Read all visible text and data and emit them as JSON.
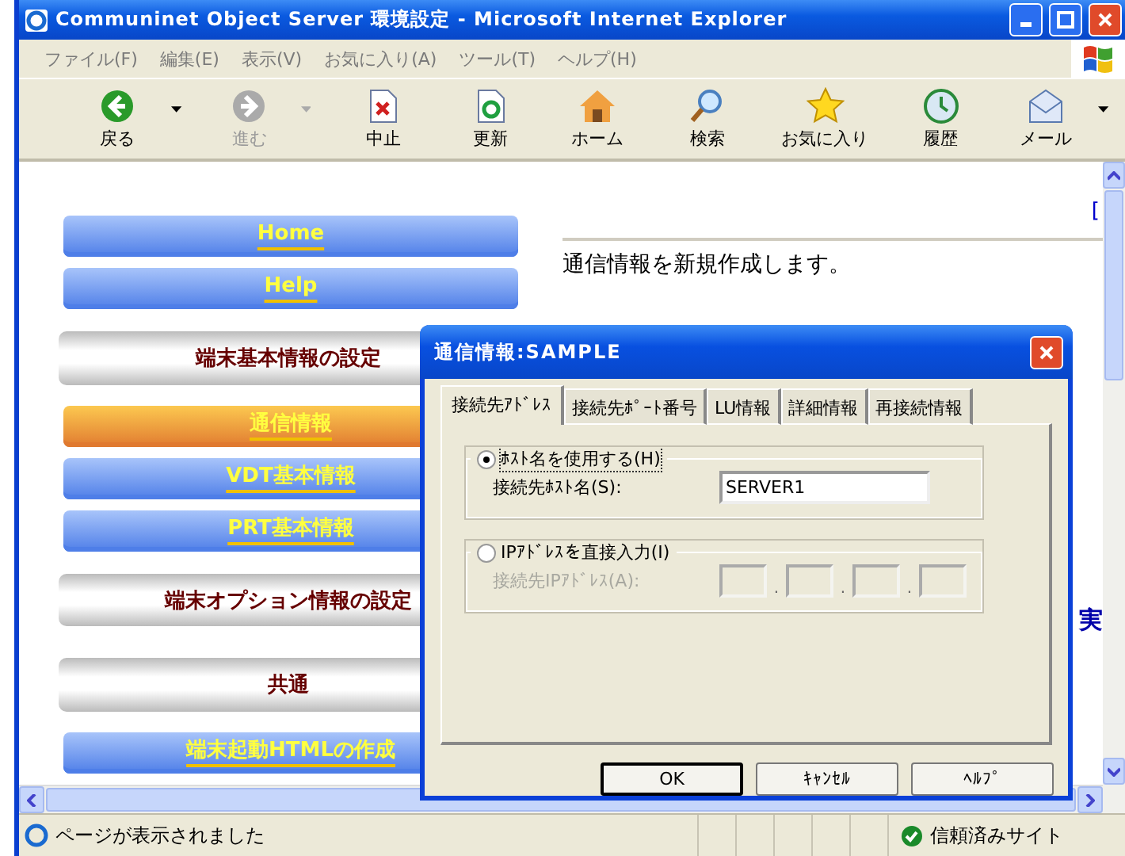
{
  "window": {
    "title": "Communinet Object Server 環境設定 - Microsoft Internet Explorer"
  },
  "menu": [
    "ファイル(F)",
    "編集(E)",
    "表示(V)",
    "お気に入り(A)",
    "ツール(T)",
    "ヘルプ(H)"
  ],
  "toolbar": [
    {
      "label": "戻る",
      "kind": "back",
      "disabled": false,
      "dropdown": true
    },
    {
      "label": "進む",
      "kind": "forward",
      "disabled": true,
      "dropdown": true
    },
    {
      "label": "中止",
      "kind": "stop",
      "disabled": false,
      "dropdown": false
    },
    {
      "label": "更新",
      "kind": "refresh",
      "disabled": false,
      "dropdown": false
    },
    {
      "label": "ホーム",
      "kind": "home",
      "disabled": false,
      "dropdown": false
    },
    {
      "label": "検索",
      "kind": "search",
      "disabled": false,
      "dropdown": false
    },
    {
      "label": "お気に入り",
      "kind": "favorites",
      "disabled": false,
      "dropdown": false
    },
    {
      "label": "履歴",
      "kind": "history",
      "disabled": false,
      "dropdown": false
    },
    {
      "label": "メール",
      "kind": "mail",
      "disabled": false,
      "dropdown": true
    }
  ],
  "nav": [
    {
      "label": "Home",
      "kind": "link",
      "selected": false
    },
    {
      "label": "Help",
      "kind": "link",
      "selected": false
    },
    {
      "label": "端末基本情報の設定",
      "kind": "section"
    },
    {
      "label": "通信情報",
      "kind": "link",
      "selected": true
    },
    {
      "label": "VDT基本情報",
      "kind": "link",
      "selected": false
    },
    {
      "label": "PRT基本情報",
      "kind": "link",
      "selected": false
    },
    {
      "label": "端末オプション情報の設定",
      "kind": "section"
    },
    {
      "label": "共通",
      "kind": "section"
    },
    {
      "label": "端末起動HTMLの作成",
      "kind": "link",
      "selected": false
    }
  ],
  "page": {
    "link": "[",
    "message": "通信情報を新規作成します。",
    "side_text": "実"
  },
  "dialog": {
    "title": "通信情報:SAMPLE",
    "tabs": [
      {
        "label": "接続先ｱﾄﾞﾚｽ",
        "selected": true
      },
      {
        "label": "接続先ﾎﾟｰﾄ番号",
        "selected": false
      },
      {
        "label": "LU情報",
        "selected": false
      },
      {
        "label": "詳細情報",
        "selected": false
      },
      {
        "label": "再接続情報",
        "selected": false
      }
    ],
    "groups": [
      {
        "label": "ﾎｽﾄ名を使用する(H)",
        "selected": true,
        "disabled": false,
        "field_label": "接続先ﾎｽﾄ名(S):",
        "kind": "text",
        "value": "SERVER1"
      },
      {
        "label": "IPｱﾄﾞﾚｽを直接入力(I)",
        "selected": false,
        "disabled": true,
        "field_label": "接続先IPｱﾄﾞﾚｽ(A):",
        "kind": "ip",
        "separators": [
          ".",
          ".",
          "."
        ]
      }
    ],
    "buttons": [
      {
        "label": "OK",
        "default": true
      },
      {
        "label": "ｷｬﾝｾﾙ",
        "default": false
      },
      {
        "label": "ﾍﾙﾌﾟ",
        "default": false
      }
    ]
  },
  "status": {
    "text": "ページが表示されました",
    "zone": "信頼済みサイト"
  }
}
